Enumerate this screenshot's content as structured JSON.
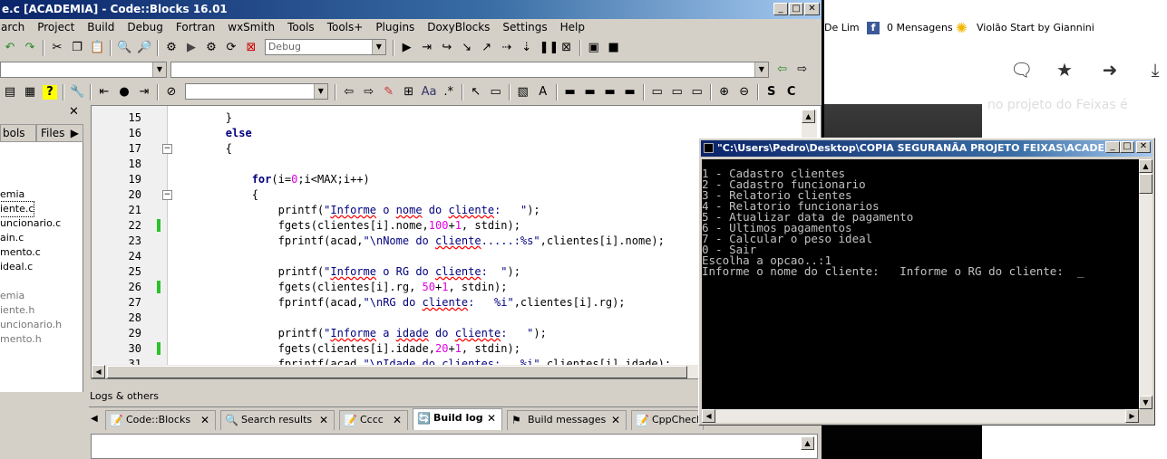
{
  "cb": {
    "title": "e.c [ACADEMIA] - Code::Blocks 16.01",
    "menu": [
      "arch",
      "Project",
      "Build",
      "Debug",
      "Fortran",
      "wxSmith",
      "Tools",
      "Tools+",
      "Plugins",
      "DoxyBlocks",
      "Settings",
      "Help"
    ],
    "build_target": "Debug",
    "tabs": {
      "symbols": "bols",
      "files": "Files"
    },
    "tree": [
      "emia",
      "iente.c",
      "uncionario.c",
      "ain.c",
      "mento.c",
      "ideal.c",
      "",
      "emia",
      "iente.h",
      "uncionario.h",
      "mento.h"
    ],
    "code_lines": [
      {
        "n": "15",
        "html": "        }"
      },
      {
        "n": "16",
        "html": "        <span class='kw'>else</span>"
      },
      {
        "n": "17",
        "html": "        {"
      },
      {
        "n": "18",
        "html": ""
      },
      {
        "n": "19",
        "html": "            <span class='kw'>for</span>(i=<span class='num'>0</span>;i&lt;MAX;i++)"
      },
      {
        "n": "20",
        "html": "            {"
      },
      {
        "n": "21",
        "html": "                printf(<span class='str'>\"<span class='sq'>Informe</span> o <span class='sq'>nome</span> do <span class='sq'>cliente</span>:   \"</span>);"
      },
      {
        "n": "22",
        "html": "                fgets(clientes[i].nome,<span class='num'>100</span>+<span class='num'>1</span>, stdin);"
      },
      {
        "n": "23",
        "html": "                fprintf(acad,<span class='str'>\"\\nNome do <span class='sq'>cliente</span>.....:%s\"</span>,clientes[i].nome);"
      },
      {
        "n": "24",
        "html": ""
      },
      {
        "n": "25",
        "html": "                printf(<span class='str'>\"<span class='sq'>Informe</span> o RG do <span class='sq'>cliente</span>:  \"</span>);"
      },
      {
        "n": "26",
        "html": "                fgets(clientes[i].rg, <span class='num'>50</span>+<span class='num'>1</span>, stdin);"
      },
      {
        "n": "27",
        "html": "                fprintf(acad,<span class='str'>\"\\nRG do <span class='sq'>cliente</span>:   %i\"</span>,clientes[i].rg);"
      },
      {
        "n": "28",
        "html": ""
      },
      {
        "n": "29",
        "html": "                printf(<span class='str'>\"<span class='sq'>Informe</span> a <span class='sq'>idade</span> do <span class='sq'>cliente</span>:   \"</span>);"
      },
      {
        "n": "30",
        "html": "                fgets(clientes[i].idade,<span class='num'>20</span>+<span class='num'>1</span>, stdin);"
      },
      {
        "n": "31",
        "html": "                fprintf(acad,<span class='str'>\"\\nIdade do clientes:   %i\"</span>,clientes[i].idade);"
      }
    ],
    "logs_title": "Logs & others",
    "log_tabs": [
      "Code::Blocks",
      "Search results",
      "Cccc",
      "Build log",
      "Build messages",
      "CppCheck"
    ]
  },
  "browser": {
    "bookmarks": [
      "De Lim",
      "0 Mensagens",
      "Violão Start by Giannini"
    ],
    "faint_text": "no projeto do Feixas é"
  },
  "console": {
    "title": "\"C:\\Users\\Pedro\\Desktop\\COPIA SEGURANÃA PROJETO FEIXAS\\ACADEMI...",
    "lines": [
      "1 - Cadastro clientes",
      "2 - Cadastro funcionario",
      "3 - Relatorio clientes",
      "4 - Relatorio funcionarios",
      "5 - Atualizar data de pagamento",
      "6 - Ultimos pagamentos",
      "7 - Calcular o peso ideal",
      "0 - Sair",
      "Escolha a opcao..:1",
      "Informe o nome do cliente:   Informe o RG do cliente:  _"
    ]
  }
}
